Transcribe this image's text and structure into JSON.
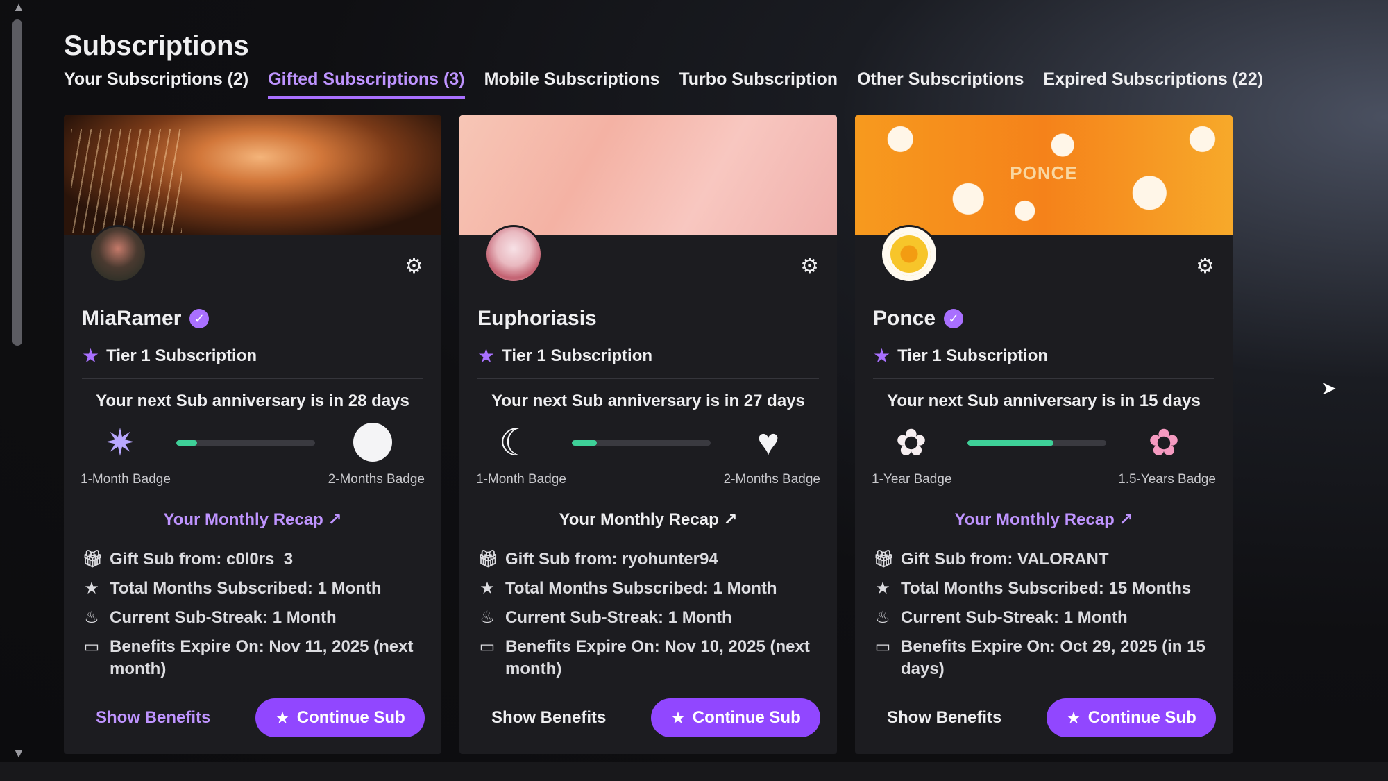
{
  "page": {
    "title": "Subscriptions"
  },
  "tabs": [
    {
      "label": "Your Subscriptions (2)",
      "active": false
    },
    {
      "label": "Gifted Subscriptions (3)",
      "active": true
    },
    {
      "label": "Mobile Subscriptions",
      "active": false
    },
    {
      "label": "Turbo Subscription",
      "active": false
    },
    {
      "label": "Other Subscriptions",
      "active": false
    },
    {
      "label": "Expired Subscriptions (22)",
      "active": false
    }
  ],
  "colors": {
    "accent": "#a970ff",
    "progress": "#3ed098",
    "button": "#9147ff"
  },
  "cards": [
    {
      "name": "MiaRamer",
      "verified": true,
      "banner_text": "",
      "tier": "Tier 1 Subscription",
      "anniversary": "Your next Sub anniversary is in 28 days",
      "badge_left": {
        "icon": "sparkle-badge-icon",
        "label": "1-Month Badge"
      },
      "badge_right": {
        "icon": "white-circle-badge-icon",
        "label": "2-Months Badge"
      },
      "progress_fraction": 0.15,
      "recap": "Your Monthly Recap ↗",
      "gift_from": "Gift Sub from: c0l0rs_3",
      "total_months": "Total Months Subscribed: 1 Month",
      "streak": "Current Sub-Streak: 1 Month",
      "expires": "Benefits Expire On: Nov 11, 2025 (next month)",
      "show_benefits": "Show Benefits",
      "continue": "Continue Sub"
    },
    {
      "name": "Euphoriasis",
      "verified": false,
      "banner_text": "",
      "tier": "Tier 1 Subscription",
      "anniversary": "Your next Sub anniversary is in 27 days",
      "badge_left": {
        "icon": "moon-badge-icon",
        "label": "1-Month Badge"
      },
      "badge_right": {
        "icon": "heart-badge-icon",
        "label": "2-Months Badge"
      },
      "progress_fraction": 0.18,
      "recap": "Your Monthly Recap ↗",
      "gift_from": "Gift Sub from: ryohunter94",
      "total_months": "Total Months Subscribed: 1 Month",
      "streak": "Current Sub-Streak: 1 Month",
      "expires": "Benefits Expire On: Nov 10, 2025 (next month)",
      "show_benefits": "Show Benefits",
      "continue": "Continue Sub"
    },
    {
      "name": "Ponce",
      "verified": true,
      "banner_text": "PONCE",
      "tier": "Tier 1 Subscription",
      "anniversary": "Your next Sub anniversary is in 15 days",
      "badge_left": {
        "icon": "white-flower-badge-icon",
        "label": "1-Year Badge"
      },
      "badge_right": {
        "icon": "pink-flower-badge-icon",
        "label": "1.5-Years Badge"
      },
      "progress_fraction": 0.62,
      "recap": "Your Monthly Recap ↗",
      "gift_from": "Gift Sub from: VALORANT",
      "total_months": "Total Months Subscribed: 15 Months",
      "streak": "Current Sub-Streak: 1 Month",
      "expires": "Benefits Expire On: Oct 29, 2025 (in 15 days)",
      "show_benefits": "Show Benefits",
      "continue": "Continue Sub"
    }
  ]
}
